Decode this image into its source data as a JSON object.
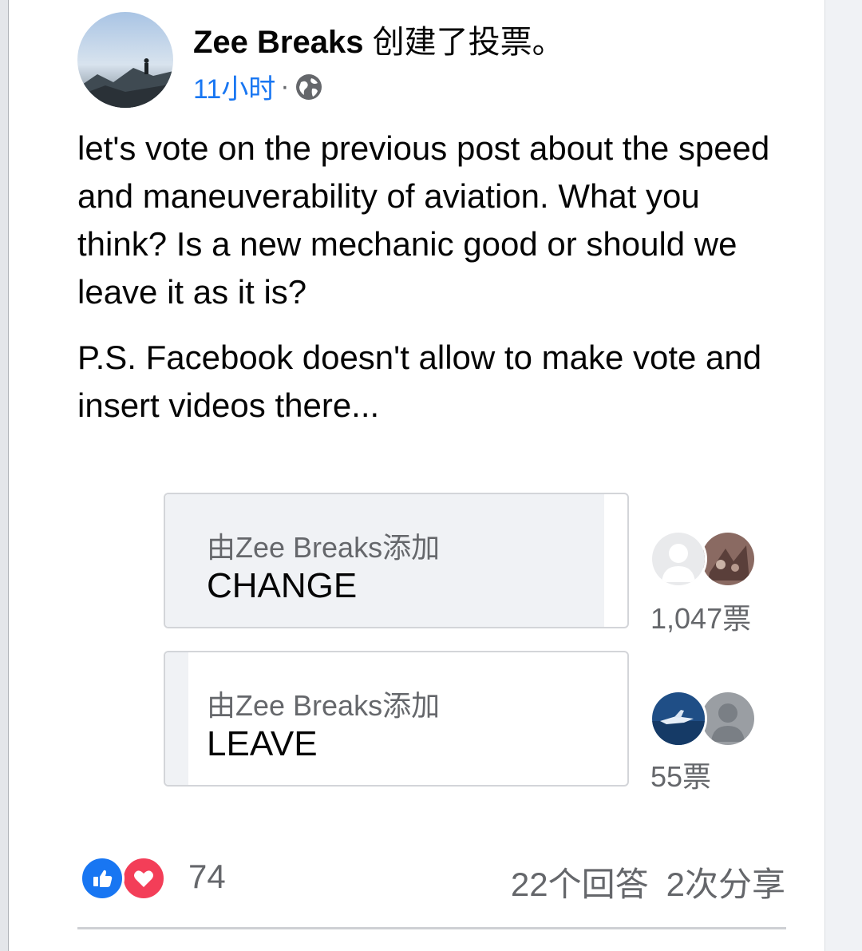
{
  "post": {
    "author": "Zee Breaks",
    "action": "创建了投票。",
    "time": "11小时",
    "separator": "·",
    "privacy_icon": "globe-icon",
    "text": "let's vote on the previous post about the speed and maneuverability of aviation. What you think? Is a new mechanic good or should we leave it as it is?",
    "ps": "P.S. Facebook doesn't allow to make vote and insert videos there..."
  },
  "poll": {
    "options": [
      {
        "added_by": "由Zee Breaks添加",
        "label": "CHANGE",
        "votes": "1,047票",
        "vote_share": 0.95
      },
      {
        "added_by": "由Zee Breaks添加",
        "label": "LEAVE",
        "votes": "55票",
        "vote_share": 0.05
      }
    ]
  },
  "footer": {
    "reactions": [
      "like-icon",
      "love-icon"
    ],
    "reaction_count": "74",
    "comments": "22个回答",
    "shares": "2次分享"
  },
  "colors": {
    "link_blue": "#1876f2",
    "like_blue": "#1876f2",
    "love_red": "#f33e58",
    "poll_fill": "#f0f2f5",
    "secondary_text": "#65676b"
  }
}
